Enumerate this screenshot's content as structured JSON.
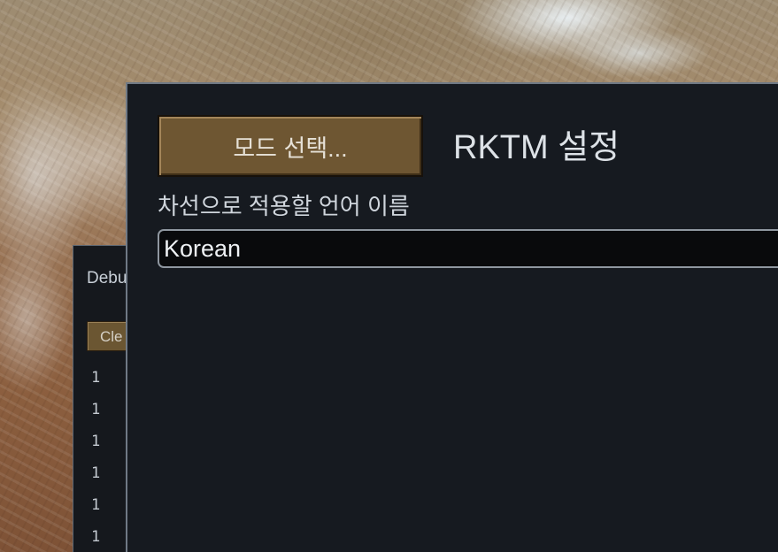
{
  "debug_window": {
    "title": "Debu",
    "clear_button_label": "Cle",
    "lines": [
      "1",
      "1",
      "1",
      "1",
      "1",
      "1"
    ]
  },
  "settings_window": {
    "title": "RKTM 설정",
    "mode_select_button_label": "모드 선택...",
    "language_field": {
      "label": "차선으로 적용할 언어 이름",
      "value": "Korean"
    }
  }
}
